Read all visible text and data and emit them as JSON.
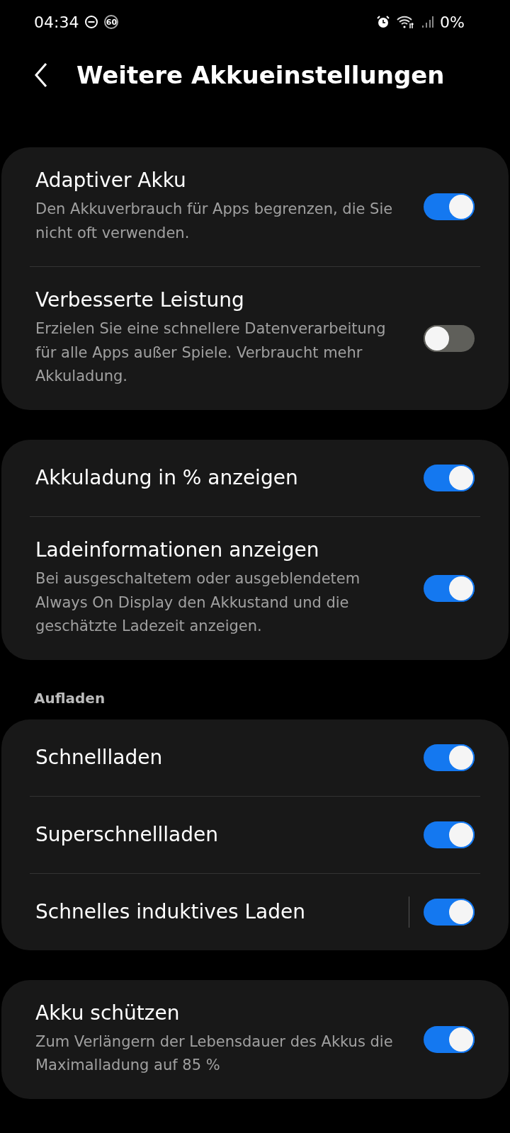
{
  "status_bar": {
    "time": "04:34",
    "refresh_rate": "60",
    "battery": "0%"
  },
  "header": {
    "title": "Weitere Akkueinstellungen"
  },
  "groups": [
    {
      "items": [
        {
          "kind": "switch",
          "title": "Adaptiver Akku",
          "subtitle": "Den Akkuverbrauch für Apps begrenzen, die Sie nicht oft verwenden.",
          "on": true
        },
        {
          "kind": "switch",
          "title": "Verbesserte Leistung",
          "subtitle": "Erzielen Sie eine schnellere Datenverarbeitung für alle Apps außer Spiele. Verbraucht mehr Akkuladung.",
          "on": false
        }
      ]
    },
    {
      "items": [
        {
          "kind": "switch",
          "title": "Akkuladung in % anzeigen",
          "on": true
        },
        {
          "kind": "switch",
          "title": "Ladeinformationen anzeigen",
          "subtitle": "Bei ausgeschaltetem oder ausgeblendetem Always On Display den Akkustand und die geschätzte Ladezeit anzeigen.",
          "on": true
        }
      ]
    },
    {
      "header": "Aufladen",
      "items": [
        {
          "kind": "switch",
          "title": "Schnellladen",
          "on": true
        },
        {
          "kind": "switch",
          "title": "Superschnellladen",
          "on": true
        },
        {
          "kind": "split",
          "title": "Schnelles induktives Laden",
          "on": true
        }
      ]
    },
    {
      "items": [
        {
          "kind": "switch",
          "title": "Akku schützen",
          "subtitle": "Zum Verlängern der Lebensdauer des Akkus die Maximalladung auf 85 %",
          "on": true
        }
      ]
    }
  ]
}
